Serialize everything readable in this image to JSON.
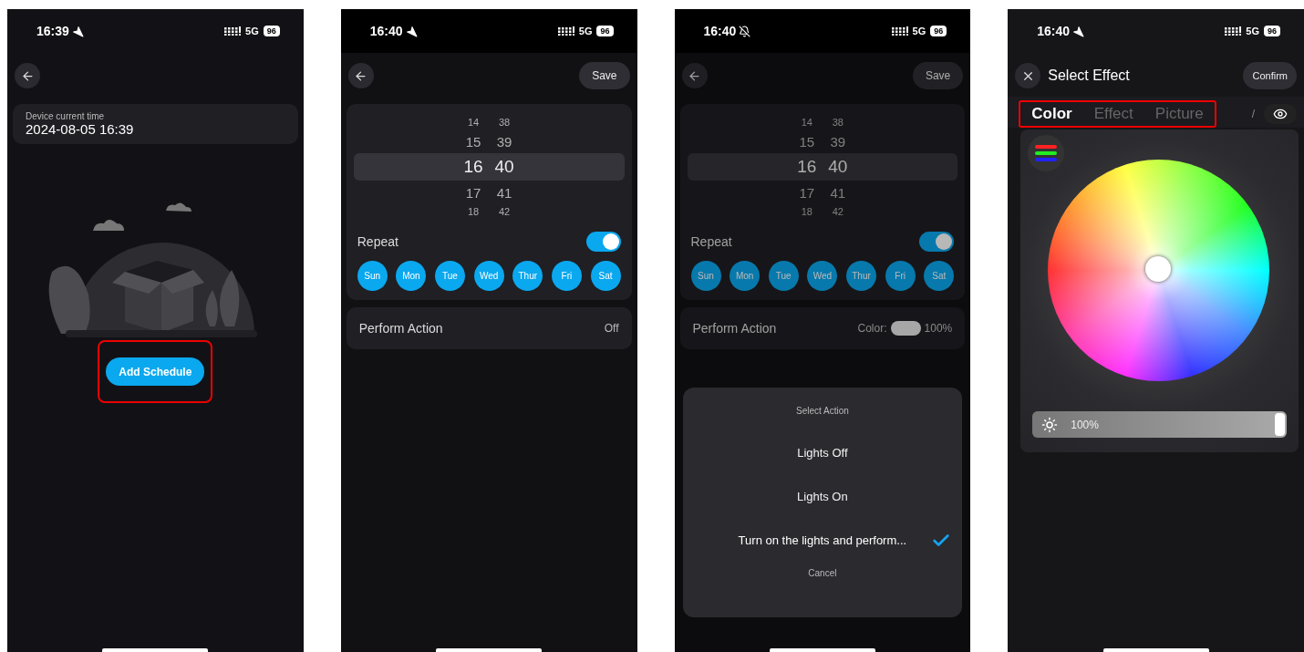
{
  "screens": [
    {
      "kind": "schedule_empty",
      "status": {
        "time": "16:39",
        "network": "5G",
        "battery": "96"
      },
      "device_time_label": "Device current time",
      "device_time": "2024-08-05 16:39",
      "add_button": {
        "label": "Add Schedule",
        "highlighted": true
      }
    },
    {
      "kind": "schedule_edit",
      "dimmed": false,
      "status": {
        "time": "16:40",
        "network": "5G",
        "battery": "96"
      },
      "save": "Save",
      "picker": {
        "hours": [
          "14",
          "15",
          "16",
          "17",
          "18"
        ],
        "minutes": [
          "38",
          "39",
          "40",
          "41",
          "42"
        ]
      },
      "repeat": {
        "label": "Repeat",
        "on": true
      },
      "days": [
        {
          "label": "Sun",
          "selected": true
        },
        {
          "label": "Mon",
          "selected": true
        },
        {
          "label": "Tue",
          "selected": true
        },
        {
          "label": "Wed",
          "selected": true
        },
        {
          "label": "Thur",
          "selected": true
        },
        {
          "label": "Fri",
          "selected": true
        },
        {
          "label": "Sat",
          "selected": true
        }
      ],
      "action": {
        "label": "Perform Action",
        "value": "Off"
      }
    },
    {
      "kind": "schedule_edit",
      "dimmed": true,
      "status": {
        "time": "16:40",
        "network": "5G",
        "battery": "96"
      },
      "save": "Save",
      "picker": {
        "hours": [
          "14",
          "15",
          "16",
          "17",
          "18"
        ],
        "minutes": [
          "38",
          "39",
          "40",
          "41",
          "42"
        ]
      },
      "repeat": {
        "label": "Repeat",
        "on": true
      },
      "days": [
        {
          "label": "Sun",
          "selected": true
        },
        {
          "label": "Mon",
          "selected": true
        },
        {
          "label": "Tue",
          "selected": true
        },
        {
          "label": "Wed",
          "selected": true
        },
        {
          "label": "Thur",
          "selected": true
        },
        {
          "label": "Fri",
          "selected": true
        },
        {
          "label": "Sat",
          "selected": true
        }
      ],
      "action": {
        "label": "Perform Action",
        "value": "Color:",
        "value_suffix": "100%"
      },
      "sheet": {
        "title": "Select Action",
        "options": [
          {
            "label": "Lights Off",
            "selected": false
          },
          {
            "label": "Lights On",
            "selected": false
          },
          {
            "label": "Turn on the lights and perform...",
            "selected": true
          }
        ],
        "cancel": "Cancel"
      }
    },
    {
      "kind": "select_effect",
      "status": {
        "time": "16:40",
        "network": "5G",
        "battery": "96"
      },
      "title": "Select Effect",
      "confirm": "Confirm",
      "tabs_highlighted": true,
      "tabs": [
        {
          "label": "Color",
          "selected": true
        },
        {
          "label": "Effect",
          "selected": false
        },
        {
          "label": "Picture",
          "selected": false
        }
      ],
      "tab_fragment": "/",
      "brightness": {
        "label": "100%",
        "level": 1
      }
    }
  ]
}
